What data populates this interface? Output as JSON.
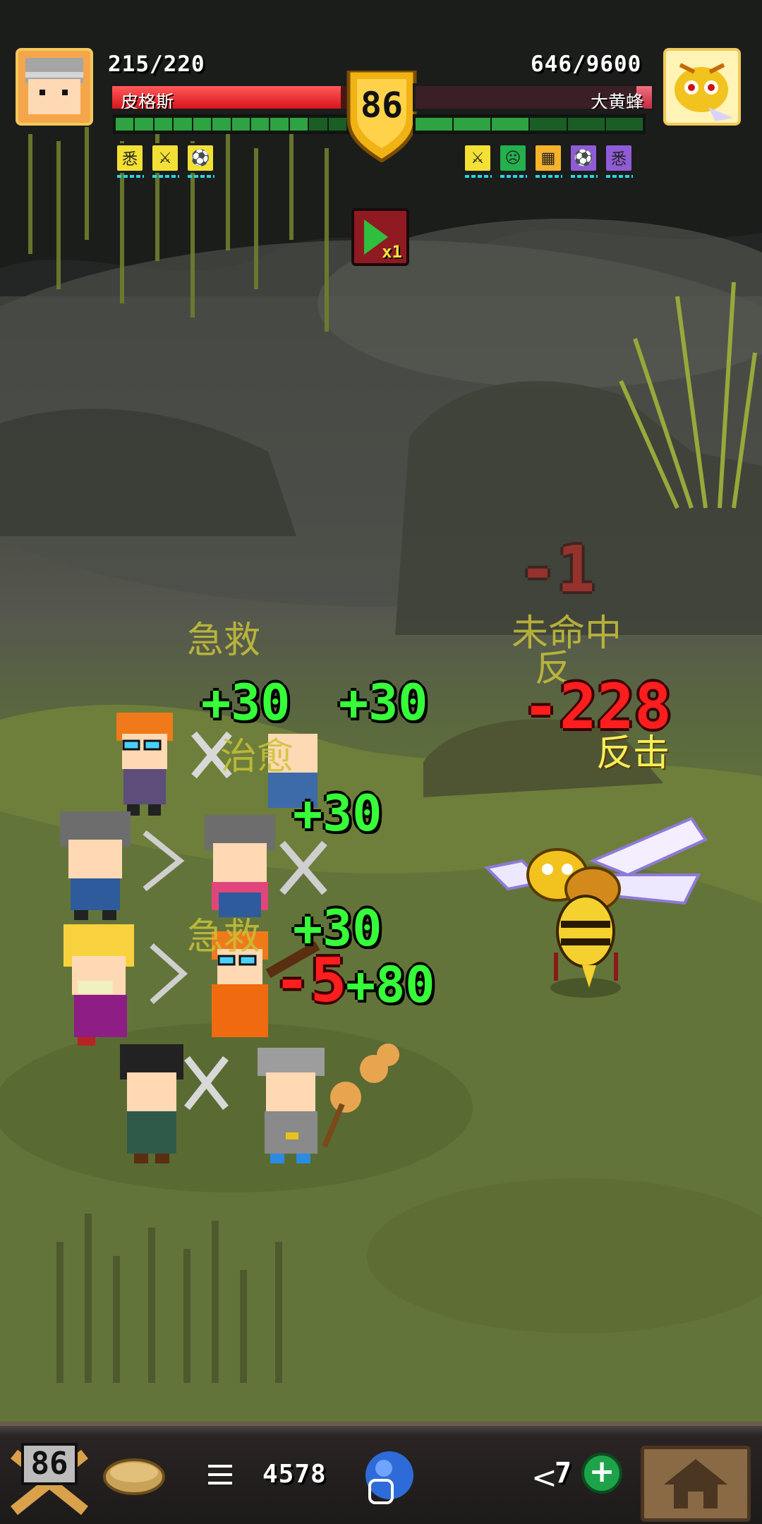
{
  "player": {
    "hp_text": "215/220",
    "name": "皮格斯",
    "hp_fraction": 0.977,
    "energy_segments_on": 10,
    "energy_segments_total": 12,
    "buffs": [
      {
        "icon": "rage-icon",
        "glyph": "悉",
        "color": "#f3e035"
      },
      {
        "icon": "sword-icon",
        "glyph": "⚔",
        "color": "#f3e035"
      },
      {
        "icon": "ball-icon",
        "glyph": "⚽",
        "color": "#f3e035"
      }
    ]
  },
  "boss": {
    "hp_text": "646/9600",
    "name": "大黄蜂",
    "hp_fraction": 0.067,
    "energy_segments_on": 3,
    "energy_segments_total": 6,
    "buffs": [
      {
        "icon": "sword-icon",
        "glyph": "⚔",
        "color": "#f3e035"
      },
      {
        "icon": "angry-face-icon",
        "glyph": "☹",
        "color": "#22b14c"
      },
      {
        "icon": "armor-icon",
        "glyph": "▦",
        "color": "#f5b22a"
      },
      {
        "icon": "ball-icon",
        "glyph": "⚽",
        "color": "#8f5cd6"
      },
      {
        "icon": "rage-icon",
        "glyph": "悉",
        "color": "#8f5cd6"
      }
    ]
  },
  "level": "86",
  "speed_button": {
    "label": "x1",
    "icon": "play-speed-icon"
  },
  "combat_text": {
    "heals": [
      "+30",
      "+30",
      "+30",
      "+30",
      "+80"
    ],
    "skills": [
      "急救",
      "治愈",
      "急救"
    ],
    "boss_texts": [
      "未命中",
      "反",
      "反击"
    ],
    "damages": [
      "-1",
      "-228",
      "-5"
    ]
  },
  "bottom_bar": {
    "level": "86",
    "gold": "4578",
    "count": "7",
    "plus_label": "+",
    "menu_icon": "menu-icon",
    "back_icon": "back-icon",
    "home_icon": "home-icon",
    "back_glyph": "<"
  },
  "colors": {
    "heal": "#36ff3a",
    "damage": "#ff1e1e",
    "skill": "#c9c23a",
    "hp_player": "#d8141c",
    "hp_boss": "#c32b3f"
  }
}
